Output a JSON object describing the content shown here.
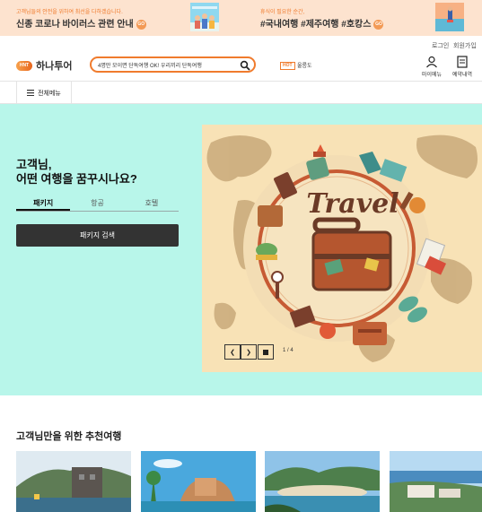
{
  "top_banner": {
    "left_small": "고객님들의 안전을 위하여 최선을 다하겠습니다.",
    "left_big": "신종 코로나 바이러스 관련 안내",
    "right_small": "휴식이 필요한 순간,",
    "right_big": "#국내여행 #제주여행 #호캉스",
    "go_label": "GO"
  },
  "util_links": {
    "login": "로그인",
    "signup": "회원가입"
  },
  "header": {
    "logo_mark": "HNT",
    "logo_text": "하나투어",
    "search_value": "4명만 모이면 단독여행 OK! 우리끼리 단독여행",
    "hot_badge": "HOT",
    "hot_keyword": "울릉도",
    "my_menu": "마이메뉴",
    "reservations": "예약내역"
  },
  "nav": {
    "all_menu": "전체메뉴"
  },
  "hero": {
    "greeting_line1": "고객님,",
    "greeting_line2": "어떤 여행을 꿈꾸시나요?",
    "tabs": [
      "패키지",
      "항공",
      "호텔"
    ],
    "active_tab": "패키지",
    "search_button": "패키지 검색",
    "image_text": "Travel",
    "pager": "1 / 4"
  },
  "recommend": {
    "title": "고객님만을 위한 추천여행"
  },
  "colors": {
    "accent": "#f07b2d",
    "hero_bg": "#b8f6ea",
    "banner_bg": "#fde3cf"
  }
}
